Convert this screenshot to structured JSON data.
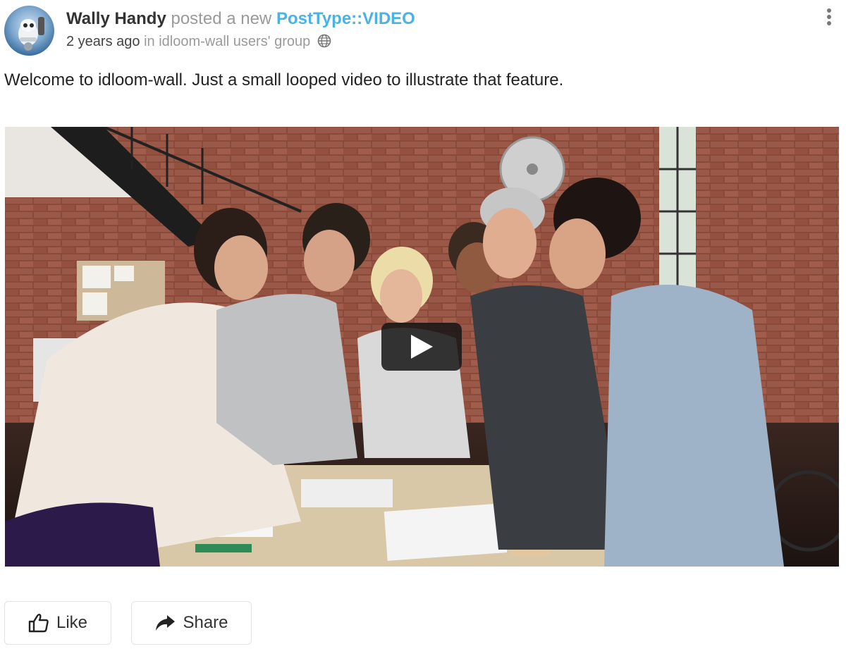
{
  "post": {
    "author": "Wally Handy",
    "action": "posted a new",
    "post_type": "PostType::VIDEO",
    "timestamp": "2 years ago",
    "group_prefix": "in",
    "group": "idloom-wall users' group",
    "body": "Welcome to idloom-wall. Just a small looped video to illustrate that feature."
  },
  "actions": {
    "like_label": "Like",
    "share_label": "Share"
  },
  "icons": {
    "menu": "kebab-menu-icon",
    "globe": "globe-icon",
    "play": "play-icon",
    "like": "thumbs-up-icon",
    "share": "share-arrow-icon"
  },
  "colors": {
    "link": "#4ab3e3",
    "muted": "#9a9a9a",
    "text": "#222222"
  }
}
